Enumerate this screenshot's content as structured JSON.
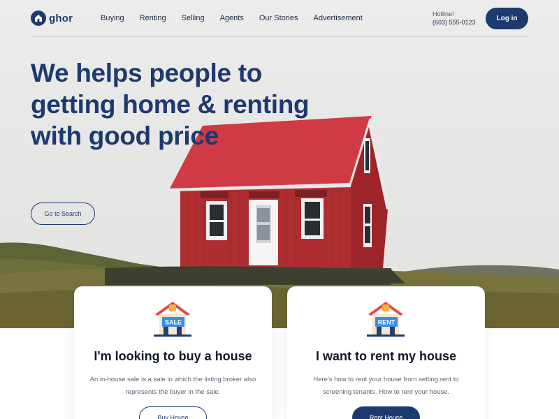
{
  "brand": {
    "name": "ghor",
    "logo_icon": "home-icon"
  },
  "nav": {
    "items": [
      {
        "label": "Buying"
      },
      {
        "label": "Renting"
      },
      {
        "label": "Selling"
      },
      {
        "label": "Agents"
      },
      {
        "label": "Our Stories"
      },
      {
        "label": "Advertisement"
      }
    ]
  },
  "hotline": {
    "label": "Hotline!",
    "phone": "(603) 555-0123"
  },
  "header": {
    "login_label": "Log in"
  },
  "hero": {
    "headline": "We helps people to getting home & renting with good price",
    "cta_label": "Go to Search"
  },
  "cards": {
    "buy": {
      "icon": "house-sale-icon",
      "badge": "SALE",
      "title": "I'm looking to buy a house",
      "description": "An in-house sale is a sale in which the listing broker also represents the buyer in the sale.",
      "button_label": "Buy House"
    },
    "rent": {
      "icon": "house-rent-icon",
      "badge": "RENT",
      "title": "I want to rent my house",
      "description": "Here's how to rent your house from setting rent to screening tenants. How to rent your house.",
      "button_label": "Rent House"
    }
  },
  "colors": {
    "primary": "#1d3a6e",
    "roof": "#cf3b44",
    "walls": "#a82a2d",
    "badge": "#3b8de0"
  }
}
